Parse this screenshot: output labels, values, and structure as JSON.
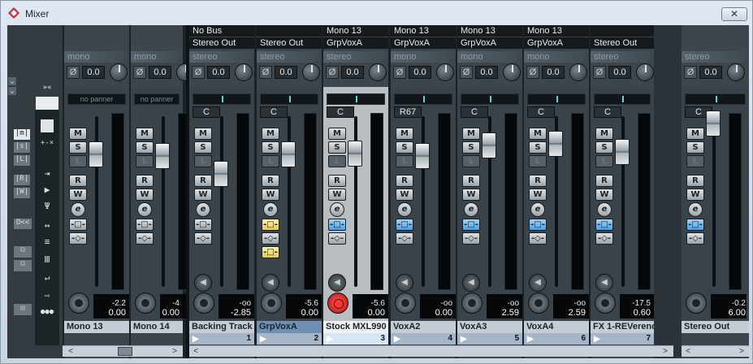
{
  "window": {
    "title": "Mixer",
    "close": "✕"
  },
  "left_strip": {
    "top_btn": "⌄",
    "btn_off": "O<<",
    "no_panner": "no panner"
  },
  "channels": [
    {
      "id": "mono13",
      "routeA": "",
      "routeB": "",
      "mode": "mono",
      "phase": "Ø",
      "gain": "0.0",
      "pan": "no panner",
      "panv": "",
      "vol_top": "-2.2",
      "vol": "0.00",
      "peak": "",
      "name": "Mono 13",
      "num": "",
      "sel": false
    },
    {
      "id": "mono14",
      "routeA": "",
      "routeB": "",
      "mode": "mono",
      "phase": "Ø",
      "gain": "0.0",
      "pan": "no panner",
      "panv": "",
      "vol_top": "-4",
      "vol": "0.00",
      "peak": "",
      "name": "Mono 14",
      "num": "",
      "sel": false
    },
    {
      "id": "backing",
      "routeA": "No Bus",
      "routeB": "Stereo Out",
      "mode": "stereo",
      "phase": "Ø",
      "gain": "0.0",
      "pan": "",
      "panv": "C",
      "vol_top": "-oo",
      "vol": "-2.85",
      "peak": "",
      "name": "Backing Track",
      "num": "1",
      "sel": false
    },
    {
      "id": "grpvox",
      "routeA": "",
      "routeB": "Stereo Out",
      "mode": "stereo",
      "phase": "Ø",
      "gain": "0.0",
      "pan": "",
      "panv": "C",
      "vol_top": "-5.6",
      "vol": "0.00",
      "peak": "",
      "name": "GrpVoxA",
      "num": "2",
      "sel": false
    },
    {
      "id": "stock",
      "routeA": "Mono 13",
      "routeB": "GrpVoxA",
      "mode": "stereo",
      "phase": "Ø",
      "gain": "0.0",
      "pan": "",
      "panv": "C",
      "vol_top": "-5.6",
      "vol": "0.00",
      "peak": "",
      "name": "Stock MXL990",
      "num": "3",
      "sel": true
    },
    {
      "id": "voxa2",
      "routeA": "Mono 13",
      "routeB": "GrpVoxA",
      "mode": "mono",
      "phase": "Ø",
      "gain": "0.0",
      "pan": "",
      "panv": "R67",
      "vol_top": "-oo",
      "vol": "0.00",
      "peak": "",
      "name": "VoxA2",
      "num": "4",
      "sel": false
    },
    {
      "id": "voxa3",
      "routeA": "Mono 13",
      "routeB": "GrpVoxA",
      "mode": "mono",
      "phase": "Ø",
      "gain": "0.0",
      "pan": "",
      "panv": "C",
      "vol_top": "-oo",
      "vol": "2.59",
      "peak": "",
      "name": "VoxA3",
      "num": "5",
      "sel": false
    },
    {
      "id": "voxa4",
      "routeA": "Mono 13",
      "routeB": "GrpVoxA",
      "mode": "mono",
      "phase": "Ø",
      "gain": "0.0",
      "pan": "",
      "panv": "C",
      "vol_top": "-oo",
      "vol": "2.59",
      "peak": "",
      "name": "VoxA4",
      "num": "6",
      "sel": false
    },
    {
      "id": "fx1",
      "routeA": "",
      "routeB": "Stereo Out",
      "mode": "stereo",
      "phase": "Ø",
      "gain": "0.0",
      "pan": "",
      "panv": "C",
      "vol_top": "-17.5",
      "vol": "0.60",
      "peak": "",
      "name": "FX 1-REVerenc",
      "num": "7",
      "sel": false
    },
    {
      "id": "stereoout",
      "routeA": "",
      "routeB": "",
      "mode": "stereo",
      "phase": "Ø",
      "gain": "0.0",
      "pan": "",
      "panv": "C",
      "vol_top": "-0.2",
      "vol": "6.00",
      "peak": "",
      "name": "Stereo Out",
      "num": "",
      "sel": false
    }
  ],
  "buttons": {
    "m": "M",
    "s": "S",
    "l": "L",
    "r": "R",
    "w": "W",
    "e": "e",
    "ins": "-□-",
    "send": "-◇-",
    "mon": "◀"
  }
}
